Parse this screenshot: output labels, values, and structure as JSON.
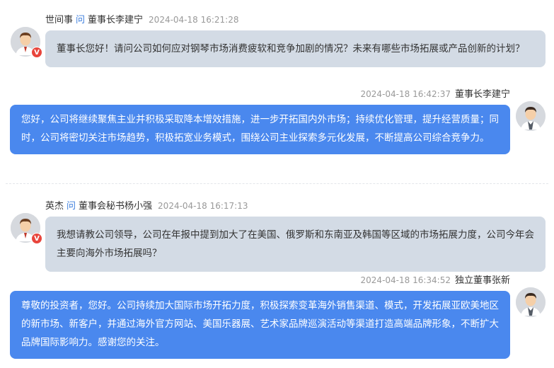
{
  "threads": [
    {
      "question": {
        "asker": "世间事",
        "wen": "问",
        "target": "董事长李建宁",
        "time": "2024-04-18 16:21:28",
        "text": "董事长您好！请问公司如何应对钢琴市场消费疲软和竞争加剧的情况？未来有哪些市场拓展或产品创新的计划？",
        "badge": "V"
      },
      "answer": {
        "time": "2024-04-18 16:42:37",
        "responder": "董事长李建宁",
        "text": "您好，公司将继续聚焦主业并积极采取降本增效措施，进一步开拓国内外市场；持续优化管理，提升经营质量；同时，公司将密切关注市场趋势，积极拓宽业务模式，围绕公司主业探索多元化发展，不断提高公司综合竞争力。"
      }
    },
    {
      "question": {
        "asker": "英杰",
        "wen": "问",
        "target": "董事会秘书杨小强",
        "time": "2024-04-18 16:17:13",
        "text": "我想请教公司领导，公司在年报中提到加大了在美国、俄罗斯和东南亚及韩国等区域的市场拓展力度，公司今年会主要向海外市场拓展吗？",
        "badge": "V"
      },
      "answer": {
        "time": "2024-04-18 16:34:52",
        "responder": "独立董事张新",
        "text": "尊敬的投资者，您好。公司持续加大国际市场开拓力度，积极探索变革海外销售渠道、模式，开发拓展亚欧美地区的新市场、新客户，并通过海外官方网站、美国乐器展、艺术家品牌巡演活动等渠道打造高端品牌形象，不断扩大品牌国际影响力。感谢您的关注。"
      }
    }
  ],
  "colors": {
    "question_bubble": "#d3dbe5",
    "answer_bubble": "#4a88ee",
    "wen_accent": "#3b7ddd",
    "badge": "#e8453c"
  }
}
